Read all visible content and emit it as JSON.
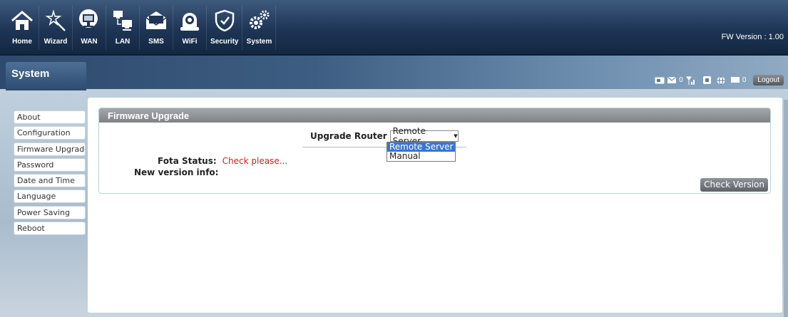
{
  "nav": {
    "items": [
      {
        "label": "Home",
        "icon": "home-icon"
      },
      {
        "label": "Wizard",
        "icon": "wand-icon"
      },
      {
        "label": "WAN",
        "icon": "monitor-globe-icon"
      },
      {
        "label": "LAN",
        "icon": "computers-icon"
      },
      {
        "label": "SMS",
        "icon": "envelope-icon"
      },
      {
        "label": "WiFi",
        "icon": "wifi-router-icon"
      },
      {
        "label": "Security",
        "icon": "shield-icon"
      },
      {
        "label": "System",
        "icon": "gears-icon"
      }
    ],
    "fw_version": "FW Version : 1.00"
  },
  "section": {
    "title": "System"
  },
  "status": {
    "sms_count": "0",
    "msg_count": "0",
    "logout_label": "Logout"
  },
  "sidebar": {
    "items": [
      {
        "label": "About"
      },
      {
        "label": "Configuration"
      },
      {
        "label": "Firmware Upgrade"
      },
      {
        "label": "Password"
      },
      {
        "label": "Date and Time"
      },
      {
        "label": "Language"
      },
      {
        "label": "Power Saving"
      },
      {
        "label": "Reboot"
      }
    ],
    "active": "Firmware Upgrade"
  },
  "firmware": {
    "header": "Firmware Upgrade",
    "upgrade_label": "Upgrade Router",
    "upgrade_selected": "Remote Server",
    "upgrade_options": [
      "Remote Server",
      "Manual"
    ],
    "fota_label": "Fota Status:",
    "fota_value": "Check please...",
    "version_label": "New version info:",
    "check_button": "Check Version"
  },
  "colors": {
    "nav_bg": "#1e3556",
    "status_red": "#cc1f1f",
    "selection_blue": "#3875d7",
    "header_gray": "#8f9295"
  }
}
